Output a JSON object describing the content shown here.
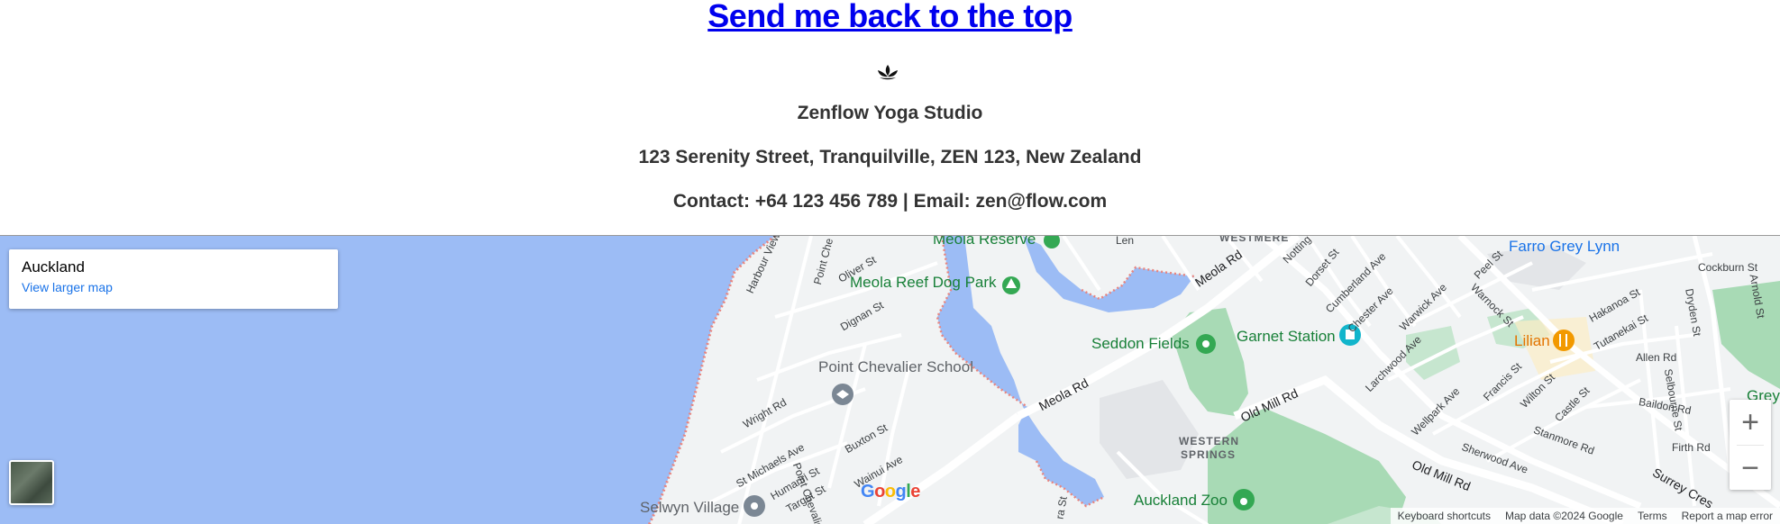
{
  "footer": {
    "back_to_top": "Send me back to the top",
    "logo_icon": "lotus-icon",
    "studio_name": "Zenflow Yoga Studio",
    "address": "123 Serenity Street, Tranquilville, ZEN 123, New Zealand",
    "contact": "Contact: +64 123 456 789 | Email: zen@flow.com"
  },
  "map": {
    "place_card": {
      "name": "Auckland",
      "larger_map_link": "View larger map"
    },
    "labels": {
      "meola_reserve": "Meola Reserve",
      "meola_reef_dog_park": "Meola Reef Dog Park",
      "point_chevalier_school": "Point Chevalier School",
      "seddon_fields": "Seddon Fields",
      "garnet_station": "Garnet Station",
      "farro_grey_lynn": "Farro Grey Lynn",
      "lilian": "Lilian",
      "auckland_zoo": "Auckland Zoo",
      "selwyn_village": "Selwyn Village",
      "western_springs_1": "WESTERN",
      "western_springs_2": "SPRINGS",
      "westmere": "WESTMERE",
      "grey": "Grey"
    },
    "streets": {
      "harbour_view_rd": "Harbour View Rd",
      "point_che": "Point Che",
      "oliver_st": "Oliver St",
      "dignan_st": "Dignan St",
      "meola_rd_upper": "Meola Rd",
      "meola_rd_lower": "Meola Rd",
      "notting": "Notting",
      "dorset_st": "Dorset St",
      "cumberland_ave": "Cumberland Ave",
      "chester_ave": "Chester Ave",
      "warwick_ave": "Warwick Ave",
      "peel_st": "Peel St",
      "warnock_st": "Warnock St",
      "cockburn_st": "Cockburn St",
      "arnold_st": "Arnold St",
      "dryden_st": "Dryden St",
      "hakanoa_st": "Hakanoa St",
      "tutanekai_st": "Tutanekai St",
      "allen_rd": "Allen Rd",
      "larchwood_ave": "Larchwood Ave",
      "francis_st": "Francis St",
      "wilton_st": "Wilton St",
      "castle_st": "Castle St",
      "baildon_rd": "Baildon Rd",
      "selbourne_st": "Selbourne St",
      "firth_rd": "Firth Rd",
      "wellpark_ave": "Wellpark Ave",
      "stanmore_rd": "Stanmore Rd",
      "sherwood_ave": "Sherwood Ave",
      "old_mill_rd_1": "Old Mill Rd",
      "old_mill_rd_2": "Old Mill Rd",
      "surrey_cres": "Surrey Cres",
      "wright_rd": "Wright Rd",
      "st_michaels_ave": "St Michaels Ave",
      "buxton_st": "Buxton St",
      "point_chevalier_rd": "Point Chevalier Rd",
      "wainui_ave": "Wainui Ave",
      "humariri_st": "Humariri St",
      "target_st": "Target St",
      "ra_st": "ra St",
      "len": "Len"
    },
    "google_logo": "Google",
    "attribution": {
      "keyboard_shortcuts": "Keyboard shortcuts",
      "map_data": "Map data ©2024 Google",
      "terms": "Terms",
      "report": "Report a map error"
    },
    "zoom": {
      "in": "+",
      "out": "−"
    },
    "colors": {
      "water": "#9cbcf5",
      "park": "#a8dab5",
      "road": "#ffffff",
      "land": "#f1f3f4"
    }
  }
}
